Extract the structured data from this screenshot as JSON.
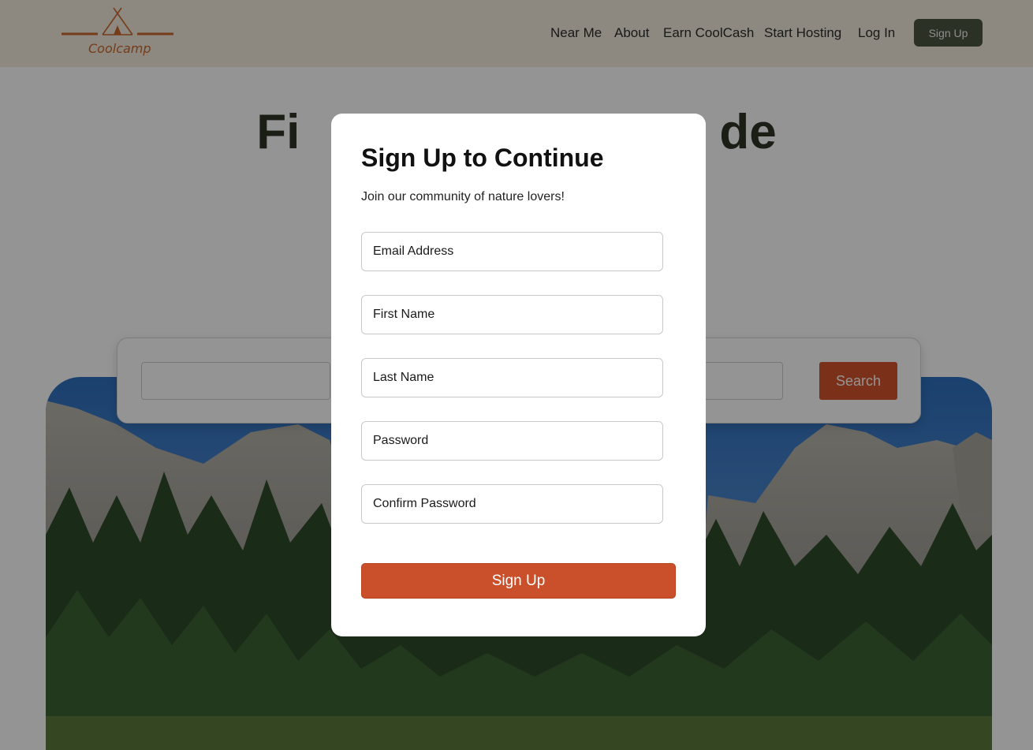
{
  "brand": {
    "name": "Coolcamp",
    "accent_color": "#c8682c"
  },
  "nav": {
    "items": [
      "Near Me",
      "About",
      "Earn CoolCash",
      "Start Hosting",
      "Log In"
    ],
    "signup_label": "Sign Up",
    "signup_color": "#4a5541"
  },
  "hero": {
    "title_left": "Fi",
    "title_right": "de"
  },
  "search": {
    "button_label": "Search",
    "button_color": "#d4532b"
  },
  "modal": {
    "title": "Sign Up to Continue",
    "subtitle": "Join our community of nature lovers!",
    "fields": {
      "email": "Email Address",
      "first_name": "First Name",
      "last_name": "Last Name",
      "password": "Password",
      "confirm_password": "Confirm Password"
    },
    "submit_label": "Sign Up",
    "submit_color": "#c9502a"
  },
  "icons": {
    "logo": "teepee-icon"
  }
}
